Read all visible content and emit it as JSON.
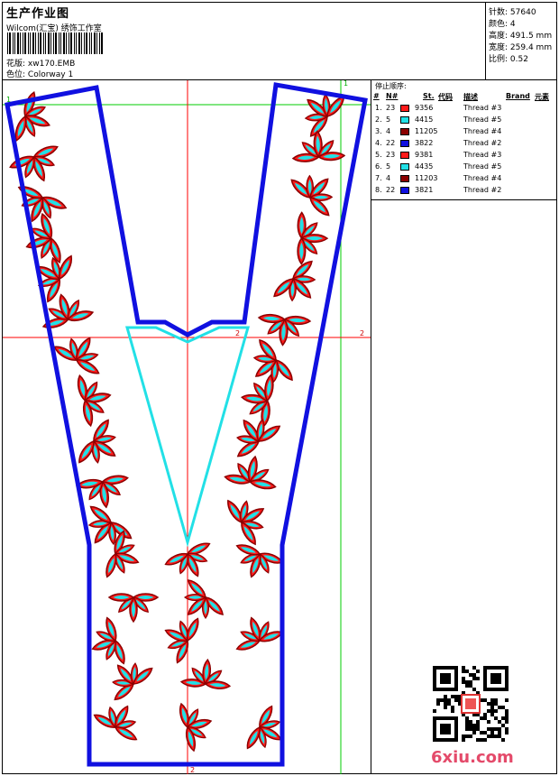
{
  "header": {
    "title": "生产作业图",
    "subtitle": "Wilcom(汇宝) 绣饰工作室",
    "design_label": "花版:",
    "design_value": "xw170.EMB",
    "colorway_label": "色位:",
    "colorway_value": "Colorway 1"
  },
  "stats": [
    {
      "label": "针数:",
      "value": "57640"
    },
    {
      "label": "颜色:",
      "value": "4"
    },
    {
      "label": "高度:",
      "value": "491.5 mm"
    },
    {
      "label": "宽度:",
      "value": "259.4 mm"
    },
    {
      "label": "比例:",
      "value": "0.52"
    }
  ],
  "legend": {
    "title": "停止顺序:",
    "headers": [
      "#",
      "N#",
      "St.",
      "代码",
      "描述",
      "Brand",
      "元素"
    ],
    "rows": [
      {
        "idx": "1.",
        "n": "23",
        "code": "9356",
        "desc": "Thread #3",
        "color": "#ff1a1a"
      },
      {
        "idx": "2.",
        "n": "5",
        "code": "4415",
        "desc": "Thread #5",
        "color": "#22e0e6"
      },
      {
        "idx": "3.",
        "n": "4",
        "code": "11205",
        "desc": "Thread #4",
        "color": "#8b0000"
      },
      {
        "idx": "4.",
        "n": "22",
        "code": "3822",
        "desc": "Thread #2",
        "color": "#1010e0"
      },
      {
        "idx": "5.",
        "n": "23",
        "code": "9381",
        "desc": "Thread #3",
        "color": "#ff1a1a"
      },
      {
        "idx": "6.",
        "n": "5",
        "code": "4435",
        "desc": "Thread #5",
        "color": "#22e0e6"
      },
      {
        "idx": "7.",
        "n": "4",
        "code": "11203",
        "desc": "Thread #4",
        "color": "#8b0000"
      },
      {
        "idx": "8.",
        "n": "22",
        "code": "3821",
        "desc": "Thread #2",
        "color": "#1010e0"
      }
    ]
  },
  "guides": {
    "top_left": "1",
    "top_right": "1",
    "right": "2",
    "bottom": "2",
    "left": "2"
  },
  "watermark": "6xiu.com",
  "colors": {
    "red": "#ff1a1a",
    "dark_red": "#8b0000",
    "cyan": "#22e0e6",
    "blue": "#1010e0",
    "guide_red": "#ff0000",
    "guide_green": "#00cc00"
  }
}
